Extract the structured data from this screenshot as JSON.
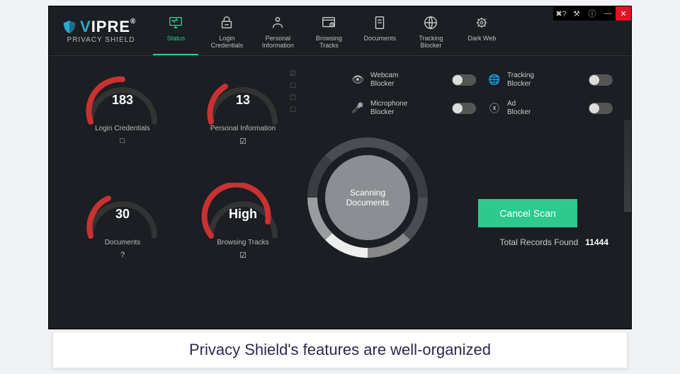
{
  "brand": {
    "name_pre": "V",
    "name_post": "IPRE",
    "sub": "PRIVACY SHIELD",
    "reg": "®"
  },
  "tabs": [
    {
      "label": "Status"
    },
    {
      "label": "Login\nCredentials"
    },
    {
      "label": "Personal\nInformation"
    },
    {
      "label": "Browsing\nTracks"
    },
    {
      "label": "Documents"
    },
    {
      "label": "Tracking\nBlocker"
    },
    {
      "label": "Dark Web"
    }
  ],
  "gauges": {
    "login": {
      "value": "183",
      "label": "Login Credentials",
      "fill": 55,
      "icon": "□"
    },
    "personal": {
      "value": "13",
      "label": "Personal Information",
      "fill": 30,
      "icon": "☑"
    },
    "docs": {
      "value": "30",
      "label": "Documents",
      "fill": 35,
      "icon": "?"
    },
    "tracks": {
      "value": "High",
      "label": "Browsing Tracks",
      "fill": 80,
      "icon": "☑"
    }
  },
  "scan_label": "Scanning\nDocuments",
  "toggles": {
    "webcam": {
      "label": "Webcam\nBlocker"
    },
    "tracking": {
      "label": "Tracking\nBlocker"
    },
    "mic": {
      "label": "Microphone\nBlocker"
    },
    "ad": {
      "label": "Ad\nBlocker"
    }
  },
  "cancel": "Cancel Scan",
  "records_label": "Total Records Found",
  "records_value": "11444",
  "caption": "Privacy Shield's features are well-organized"
}
